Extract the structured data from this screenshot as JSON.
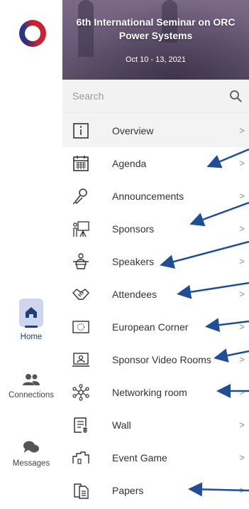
{
  "rail": {
    "items": [
      {
        "label": "Home",
        "icon": "home-icon",
        "active": true
      },
      {
        "label": "Connections",
        "icon": "people-icon"
      },
      {
        "label": "Messages",
        "icon": "chat-icon"
      }
    ]
  },
  "banner": {
    "title_line1": "6th International Seminar on ORC",
    "title_line2": "Power Systems",
    "date": "Oct 10 - 13, 2021"
  },
  "search": {
    "placeholder": "Search"
  },
  "menu": {
    "chevron": ">",
    "items": [
      {
        "label": "Overview",
        "icon": "info-icon"
      },
      {
        "label": "Agenda",
        "icon": "calendar-icon"
      },
      {
        "label": "Announcements",
        "icon": "microphone-icon"
      },
      {
        "label": "Sponsors",
        "icon": "presentation-icon"
      },
      {
        "label": "Speakers",
        "icon": "podium-icon"
      },
      {
        "label": "Attendees",
        "icon": "handshake-icon"
      },
      {
        "label": "European Corner",
        "icon": "eu-flag-icon"
      },
      {
        "label": "Sponsor Video Rooms",
        "icon": "video-room-icon"
      },
      {
        "label": "Networking room",
        "icon": "network-icon"
      },
      {
        "label": "Wall",
        "icon": "wall-icon"
      },
      {
        "label": "Event Game",
        "icon": "game-icon"
      },
      {
        "label": "Papers",
        "icon": "papers-icon"
      }
    ]
  },
  "colors": {
    "accent": "#1d3f7a",
    "arrow": "#1f4e96"
  }
}
